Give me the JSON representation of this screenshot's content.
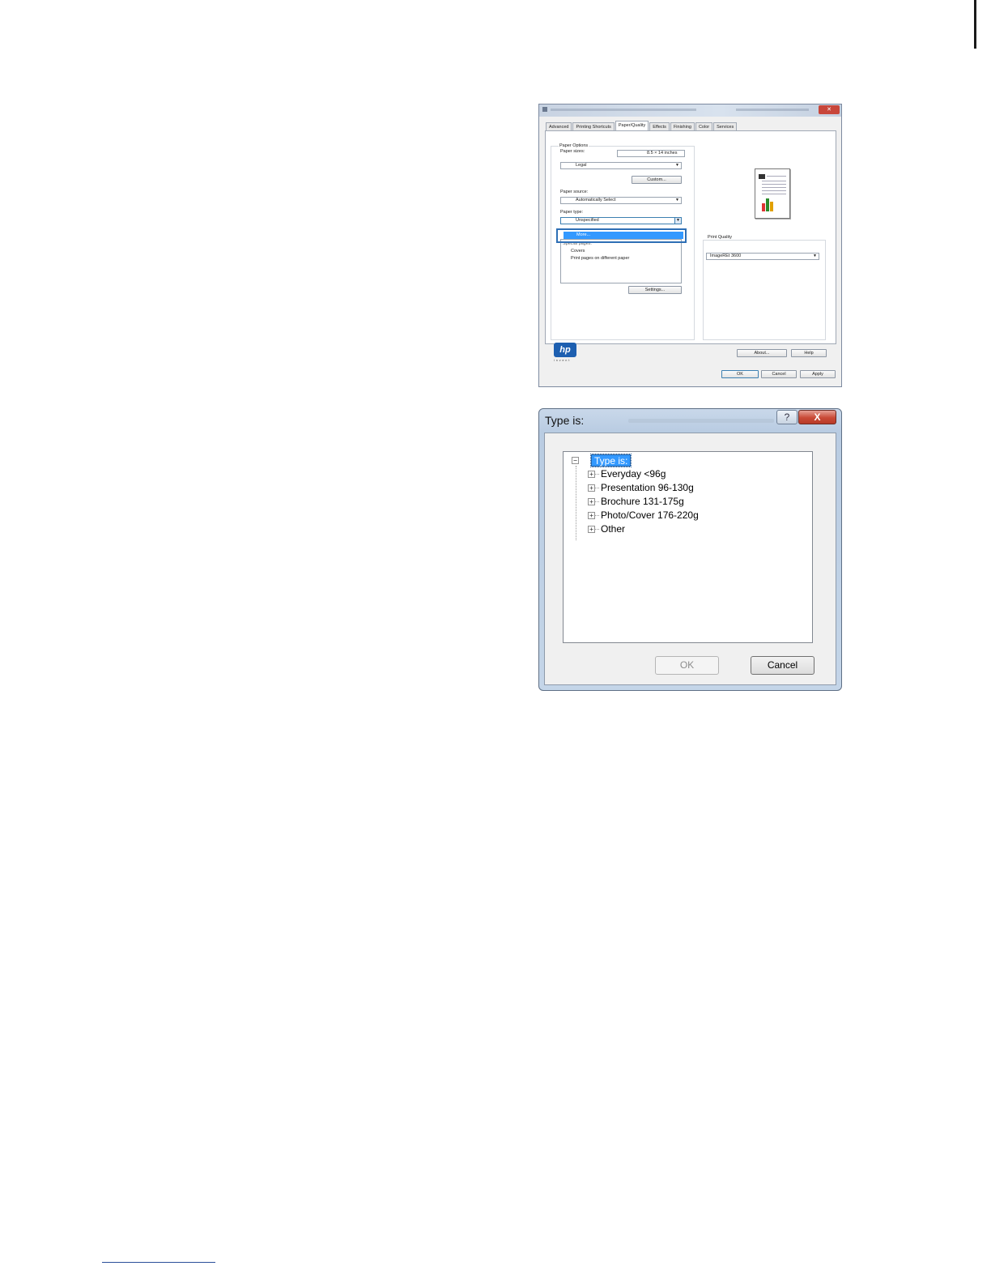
{
  "properties_dialog": {
    "tabs": [
      "Advanced",
      "Printing Shortcuts",
      "Paper/Quality",
      "Effects",
      "Finishing",
      "Color",
      "Services"
    ],
    "active_tab": "Paper/Quality",
    "paper_options_label": "Paper Options",
    "paper_sizes_label": "Paper sizes:",
    "paper_size_dimensions": "8.5 × 14 inches",
    "paper_size_value": "Legal",
    "custom_button": "Custom...",
    "paper_source_label": "Paper source:",
    "paper_source_value": "Automatically Select",
    "paper_type_label": "Paper type:",
    "paper_type_value": "Unspecified",
    "dropdown_selected": "More...",
    "special_pages_label": "Special pages:",
    "special_pages_items": [
      "Covers",
      "Print pages on different paper"
    ],
    "settings_button": "Settings...",
    "print_quality_label": "Print Quality",
    "print_quality_value": "ImageREt 3600",
    "logo_text": "hp",
    "logo_tagline": "invent",
    "about_button": "About...",
    "help_button": "Help",
    "ok_button": "OK",
    "cancel_button": "Cancel",
    "apply_button": "Apply"
  },
  "type_dialog": {
    "title": "Type is:",
    "help_glyph": "?",
    "close_glyph": "X",
    "tree_root": "Type is:",
    "tree_items": [
      "Everyday <96g",
      "Presentation 96-130g",
      "Brochure 131-175g",
      "Photo/Cover 176-220g",
      "Other"
    ],
    "ok_button": "OK",
    "cancel_button": "Cancel"
  },
  "colors": {
    "selection": "#3399ff",
    "highlight_frame": "#2e6fb5",
    "close_red": "#c94a36"
  }
}
